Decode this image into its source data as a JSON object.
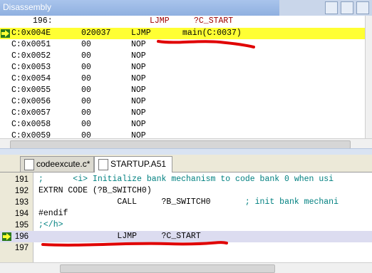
{
  "disassembly": {
    "title": "Disassembly",
    "rows": [
      {
        "addr": "196:",
        "code": "",
        "mnemonic": "LJMP",
        "operand": "?C_START",
        "kind": "src"
      },
      {
        "addr": "C:0x004E",
        "code": "020037",
        "mnemonic": "LJMP",
        "operand": "main(C:0037)",
        "kind": "cur"
      },
      {
        "addr": "C:0x0051",
        "code": "00",
        "mnemonic": "NOP",
        "operand": "",
        "kind": "asm"
      },
      {
        "addr": "C:0x0052",
        "code": "00",
        "mnemonic": "NOP",
        "operand": "",
        "kind": "asm"
      },
      {
        "addr": "C:0x0053",
        "code": "00",
        "mnemonic": "NOP",
        "operand": "",
        "kind": "asm"
      },
      {
        "addr": "C:0x0054",
        "code": "00",
        "mnemonic": "NOP",
        "operand": "",
        "kind": "asm"
      },
      {
        "addr": "C:0x0055",
        "code": "00",
        "mnemonic": "NOP",
        "operand": "",
        "kind": "asm"
      },
      {
        "addr": "C:0x0056",
        "code": "00",
        "mnemonic": "NOP",
        "operand": "",
        "kind": "asm"
      },
      {
        "addr": "C:0x0057",
        "code": "00",
        "mnemonic": "NOP",
        "operand": "",
        "kind": "asm"
      },
      {
        "addr": "C:0x0058",
        "code": "00",
        "mnemonic": "NOP",
        "operand": "",
        "kind": "asm"
      },
      {
        "addr": "C:0x0059",
        "code": "00",
        "mnemonic": "NOP",
        "operand": "",
        "kind": "asm"
      }
    ]
  },
  "tabs": [
    {
      "label": "codeexcute.c*",
      "active": false
    },
    {
      "label": "STARTUP.A51",
      "active": true
    }
  ],
  "editor": {
    "lines": [
      {
        "num": "191",
        "text": ";      <i> Initialize bank mechanism to code bank 0 when usi",
        "style": "comment"
      },
      {
        "num": "192",
        "text": "EXTRN CODE (?B_SWITCH0)",
        "style": "plain"
      },
      {
        "num": "193",
        "text": "                CALL     ?B_SWITCH0       ; init bank mechani",
        "style": "mixed"
      },
      {
        "num": "194",
        "text": "#endif",
        "style": "plain"
      },
      {
        "num": "195",
        "text": ";</h>",
        "style": "comment"
      },
      {
        "num": "196",
        "text": "                LJMP     ?C_START",
        "style": "current"
      },
      {
        "num": "197",
        "text": "",
        "style": "plain"
      }
    ],
    "line193_code": "                CALL     ?B_SWITCH0",
    "line193_comment": "       ; init bank mechani"
  },
  "colors": {
    "current_line": "#ffff33",
    "source_text": "#a00000",
    "comment": "#008080",
    "annotation": "#e00000",
    "arrow": "#2a7a1c"
  },
  "icons": [
    "current-instruction-arrow-icon",
    "file-icon"
  ]
}
